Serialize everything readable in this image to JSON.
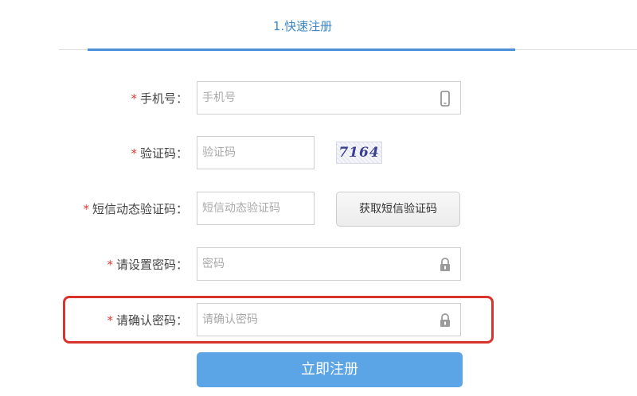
{
  "step": {
    "title": "1.快速注册"
  },
  "form": {
    "phone": {
      "required_mark": "*",
      "label": "手机号：",
      "placeholder": "手机号",
      "icon": "phone-icon"
    },
    "captcha": {
      "required_mark": "*",
      "label": "验证码：",
      "placeholder": "验证码",
      "image_text": "7164"
    },
    "sms_code": {
      "required_mark": "*",
      "label": "短信动态验证码：",
      "placeholder": "短信动态验证码",
      "button_label": "获取短信验证码"
    },
    "password": {
      "required_mark": "*",
      "label": "请设置密码：",
      "placeholder": "密码",
      "icon": "lock-icon"
    },
    "confirm_password": {
      "required_mark": "*",
      "label": "请确认密码：",
      "placeholder": "请确认密码",
      "icon": "lock-icon"
    },
    "submit_label": "立即注册"
  },
  "colors": {
    "accent": "#4a90d9",
    "required": "#e03c31",
    "highlight": "#d9342b",
    "submit": "#5ba4e6"
  }
}
